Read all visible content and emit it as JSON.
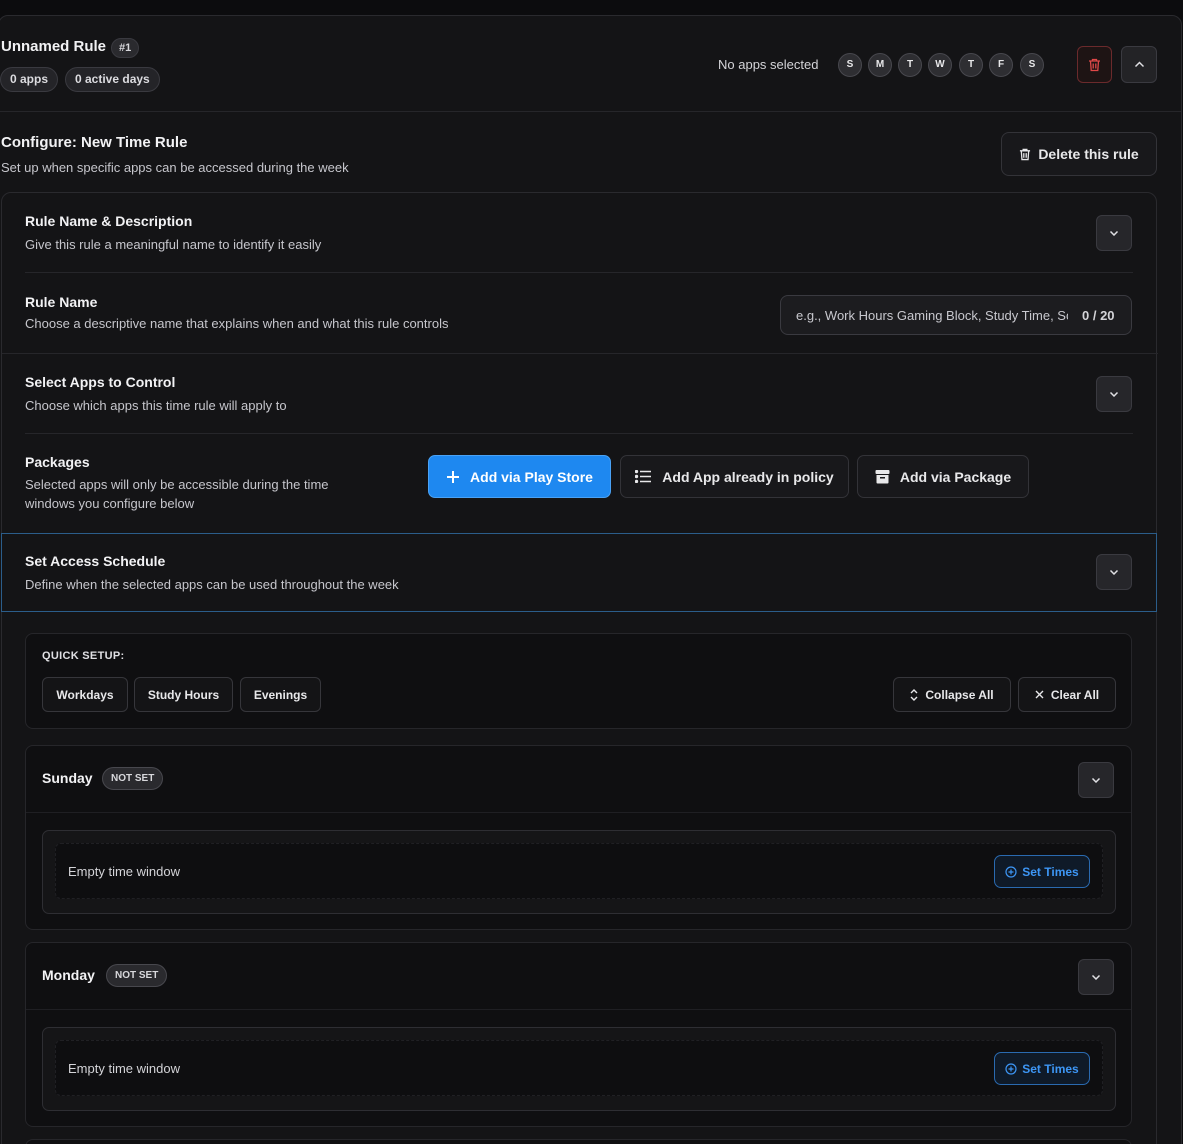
{
  "header": {
    "rule_title": "Unnamed Rule",
    "rule_number": "#1",
    "apps_pill": "0 apps",
    "days_pill": "0 active days",
    "apps_status": "No apps selected",
    "weekdays": [
      "S",
      "M",
      "T",
      "W",
      "T",
      "F",
      "S"
    ],
    "delete_icon": "trash-icon",
    "collapse_icon": "chevron-up-icon"
  },
  "configure": {
    "title": "Configure: New Time Rule",
    "subtitle": "Set up when specific apps can be accessed during the week",
    "delete_button": "Delete this rule"
  },
  "rule_name_section": {
    "title": "Rule Name & Description",
    "subtitle": "Give this rule a meaningful name to identify it easily"
  },
  "rule_name_field": {
    "label": "Rule Name",
    "help": "Choose a descriptive name that explains when and what this rule controls",
    "placeholder": "e.g., Work Hours Gaming Block, Study Time, School Hours",
    "value": "",
    "counter": "0 / 20"
  },
  "apps_section": {
    "title": "Select Apps to Control",
    "subtitle": "Choose which apps this time rule will apply to"
  },
  "packages": {
    "label": "Packages",
    "help": "Selected apps will only be accessible during the time windows you configure below",
    "add_play_store": "Add via Play Store",
    "add_policy": "Add App already in policy",
    "add_package": "Add via Package"
  },
  "schedule_section": {
    "title": "Set Access Schedule",
    "subtitle": "Define when the selected apps can be used throughout the week"
  },
  "quick_setup": {
    "label": "QUICK SETUP:",
    "presets": [
      "Workdays",
      "Study Hours",
      "Evenings"
    ],
    "collapse_all": "Collapse All",
    "clear_all": "Clear All"
  },
  "days": [
    {
      "name": "Sunday",
      "status": "NOT SET",
      "window_text": "Empty time window",
      "set_times": "Set Times"
    },
    {
      "name": "Monday",
      "status": "NOT SET",
      "window_text": "Empty time window",
      "set_times": "Set Times"
    }
  ],
  "colors": {
    "accent": "#1e88f0",
    "danger": "#e04848",
    "background": "#141416"
  }
}
